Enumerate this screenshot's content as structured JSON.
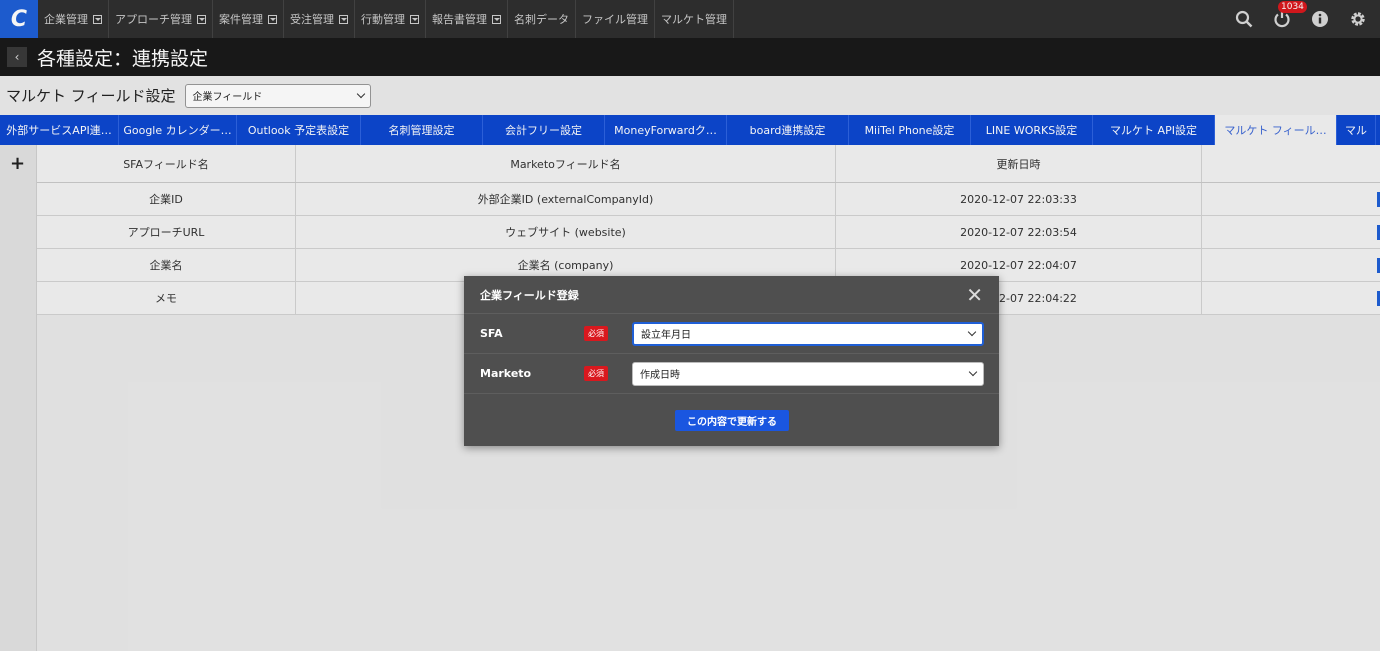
{
  "nav": {
    "logo": "C",
    "menu": [
      {
        "label": "企業管理",
        "dropdown": true
      },
      {
        "label": "アプローチ管理",
        "dropdown": true
      },
      {
        "label": "案件管理",
        "dropdown": true
      },
      {
        "label": "受注管理",
        "dropdown": true
      },
      {
        "label": "行動管理",
        "dropdown": true
      },
      {
        "label": "報告書管理",
        "dropdown": true
      },
      {
        "label": "名刺データ",
        "dropdown": false
      },
      {
        "label": "ファイル管理",
        "dropdown": false
      },
      {
        "label": "マルケト管理",
        "dropdown": false
      }
    ],
    "notification_count": "1034",
    "icons": [
      "search-icon",
      "power-icon",
      "info-icon",
      "gear-icon"
    ]
  },
  "header": {
    "back": "‹",
    "title": "各種設定：連携設定"
  },
  "fieldset": {
    "label": "マルケト フィールド設定",
    "selected": "企業フィールド"
  },
  "tabs": [
    {
      "label": "外部サービスAPI連…",
      "active": false
    },
    {
      "label": "Google カレンダー…",
      "active": false
    },
    {
      "label": "Outlook 予定表設定",
      "active": false
    },
    {
      "label": "名刺管理設定",
      "active": false
    },
    {
      "label": "会計フリー設定",
      "active": false
    },
    {
      "label": "MoneyForwardク…",
      "active": false
    },
    {
      "label": "board連携設定",
      "active": false
    },
    {
      "label": "MiiTel Phone設定",
      "active": false
    },
    {
      "label": "LINE WORKS設定",
      "active": false
    },
    {
      "label": "マルケト API設定",
      "active": false
    },
    {
      "label": "マルケト フィール…",
      "active": true
    },
    {
      "label": "マル",
      "active": false
    }
  ],
  "table": {
    "add": "+",
    "columns": [
      "SFAフィールド名",
      "Marketoフィールド名",
      "更新日時",
      ""
    ],
    "rows": [
      [
        "企業ID",
        "外部企業ID (externalCompanyId)",
        "2020-12-07 22:03:33"
      ],
      [
        "アプローチURL",
        "ウェブサイト (website)",
        "2020-12-07 22:03:54"
      ],
      [
        "企業名",
        "企業名 (company)",
        "2020-12-07 22:04:07"
      ],
      [
        "メモ",
        "",
        "2020-12-07 22:04:22"
      ]
    ]
  },
  "modal": {
    "title": "企業フィールド登録",
    "close": "✕",
    "fields": [
      {
        "label": "SFA",
        "required": "必須",
        "value": "設立年月日"
      },
      {
        "label": "Marketo",
        "required": "必須",
        "value": "作成日時"
      }
    ],
    "submit": "この内容で更新する"
  },
  "colors": {
    "accent": "#1f5fd6",
    "tab_bar": "#0d47d0",
    "required": "#d9181e",
    "modal_bg": "#4f4f4f"
  }
}
